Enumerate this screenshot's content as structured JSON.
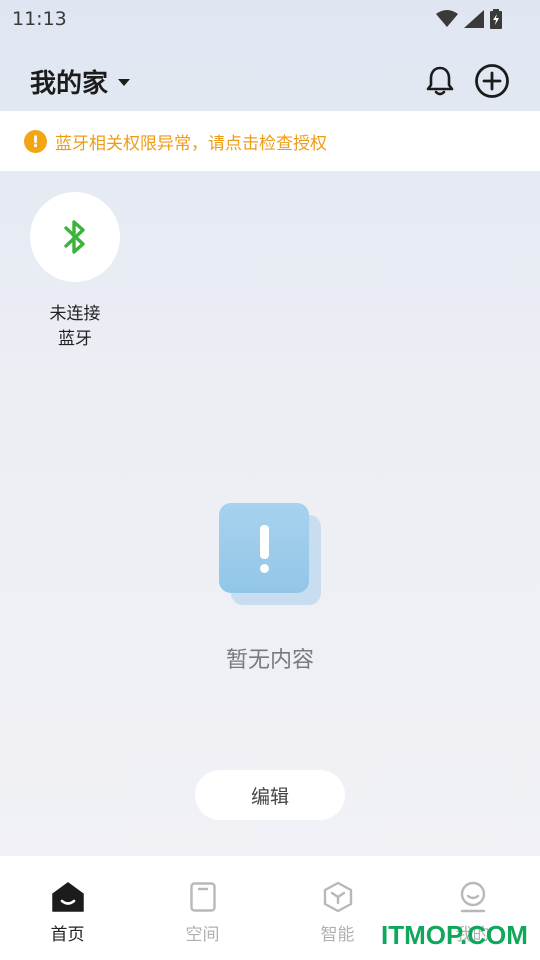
{
  "status": {
    "time": "11:13"
  },
  "header": {
    "home_title": "我的家"
  },
  "warning": {
    "text": "蓝牙相关权限异常，请点击检查授权",
    "color": "#ee9c17"
  },
  "device": {
    "label": "未连接\n蓝牙",
    "icon": "bluetooth-icon",
    "icon_color": "#3cb43c"
  },
  "empty": {
    "text": "暂无内容"
  },
  "edit_button": {
    "label": "编辑"
  },
  "tabs": [
    {
      "label": "首页",
      "icon": "home-icon",
      "active": true
    },
    {
      "label": "空间",
      "icon": "space-icon",
      "active": false
    },
    {
      "label": "智能",
      "icon": "smart-icon",
      "active": false
    },
    {
      "label": "我的",
      "icon": "profile-icon",
      "active": false
    }
  ],
  "watermark": "ITMOP.COM"
}
